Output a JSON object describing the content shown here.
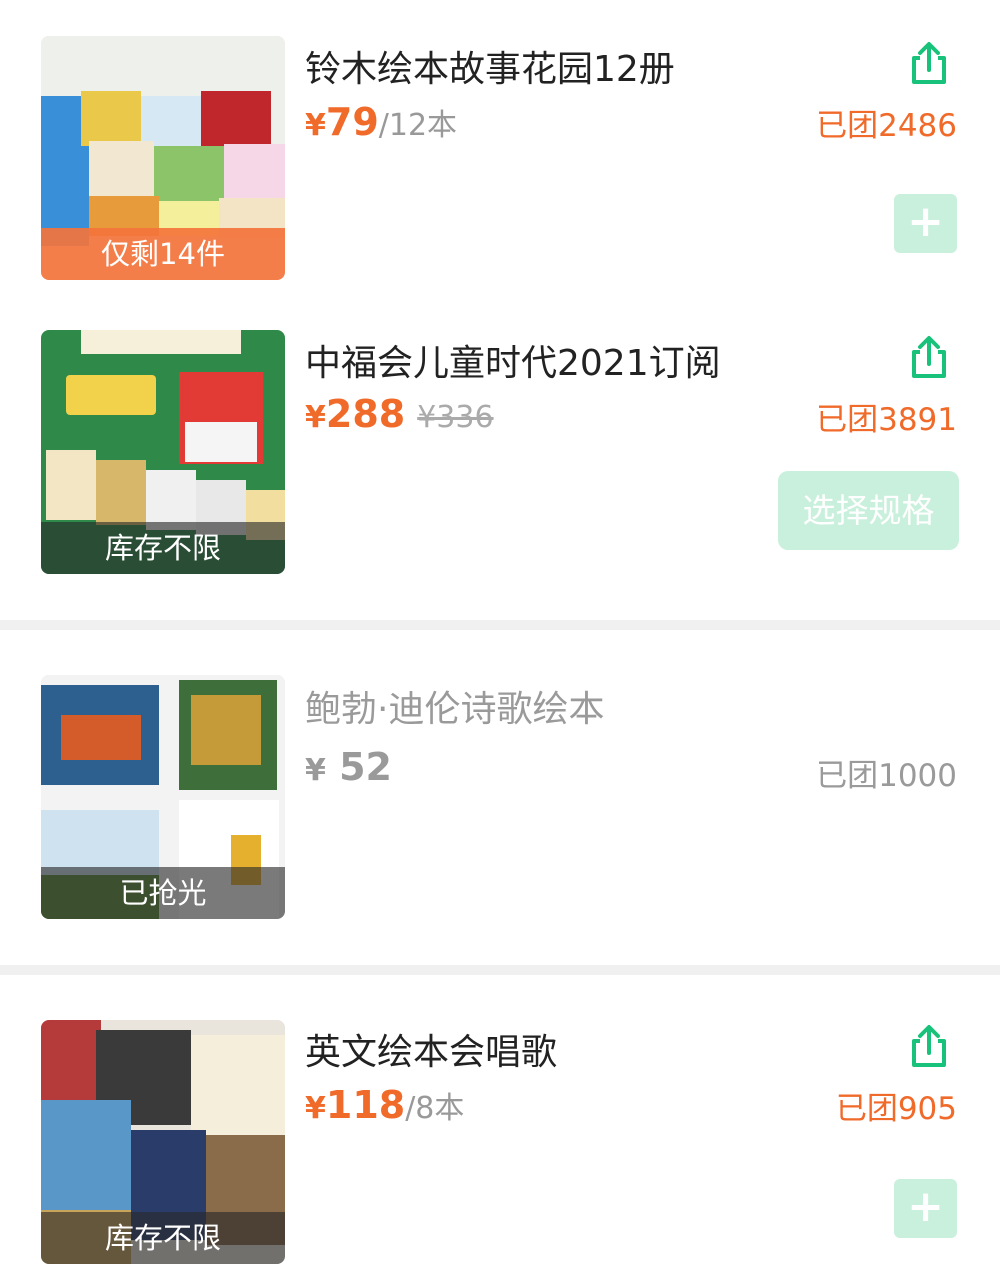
{
  "products": [
    {
      "title": "铃木绘本故事花园12册",
      "currency": "¥",
      "price": "79",
      "unit": "/12本",
      "sold": "已团2486",
      "stock": "仅剩14件",
      "action": "+"
    },
    {
      "title": "中福会儿童时代2021订阅",
      "currency": "¥",
      "price": "288",
      "original_price": "¥336",
      "sold": "已团3891",
      "stock": "库存不限",
      "action": "选择规格"
    },
    {
      "title": "鲍勃·迪伦诗歌绘本",
      "currency": "¥",
      "price": " 52",
      "sold": "已团1000",
      "stock": "已抢光"
    },
    {
      "title": "英文绘本会唱歌",
      "currency": "¥",
      "price": "118",
      "unit": "/8本",
      "sold": "已团905",
      "stock": "库存不限",
      "action": "+"
    }
  ],
  "colors": {
    "accent_orange": "#f06a2a",
    "share_green": "#19c27a",
    "button_disabled_green": "#c9f0dc",
    "muted_gray": "#9a9a9a"
  },
  "icons": {
    "share": "share-icon",
    "add": "plus-icon"
  }
}
